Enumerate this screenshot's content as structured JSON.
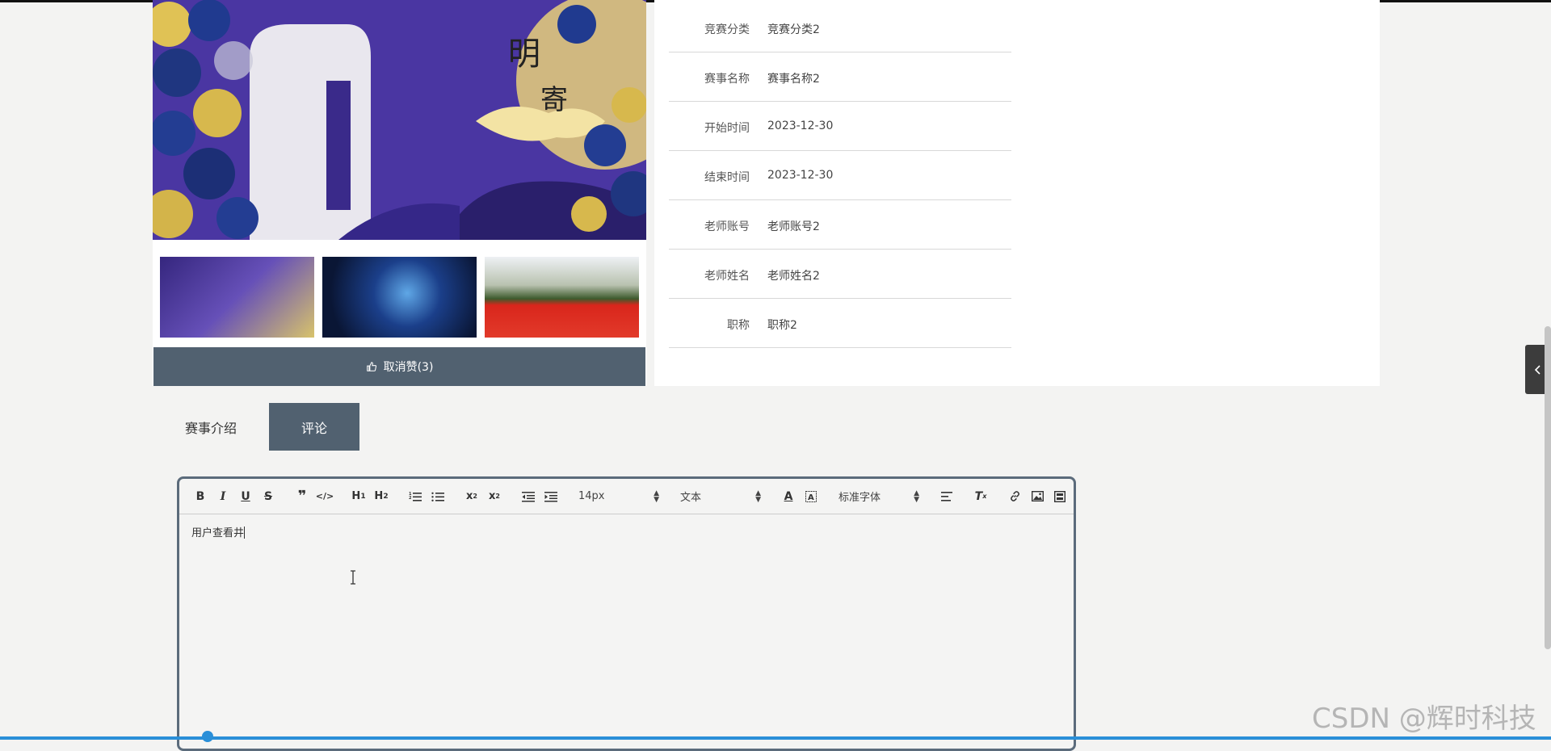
{
  "like_button": {
    "label": "取消赞(3)",
    "icon": "thumbs-up-icon"
  },
  "details": [
    {
      "label": "竞赛分类",
      "value": "竞赛分类2"
    },
    {
      "label": "赛事名称",
      "value": "赛事名称2"
    },
    {
      "label": "开始时间",
      "value": "2023-12-30"
    },
    {
      "label": "结束时间",
      "value": "2023-12-30"
    },
    {
      "label": "老师账号",
      "value": "老师账号2"
    },
    {
      "label": "老师姓名",
      "value": "老师姓名2"
    },
    {
      "label": "职称",
      "value": "职称2"
    }
  ],
  "tabs": [
    {
      "label": "赛事介绍",
      "active": false
    },
    {
      "label": "评论",
      "active": true
    }
  ],
  "editor": {
    "font_size": "14px",
    "header": "文本",
    "font_family": "标准字体",
    "content": "用户查看井"
  },
  "watermark": "CSDN @辉时科技",
  "colors": {
    "accent": "#516170",
    "progress": "#2a8fd8"
  }
}
